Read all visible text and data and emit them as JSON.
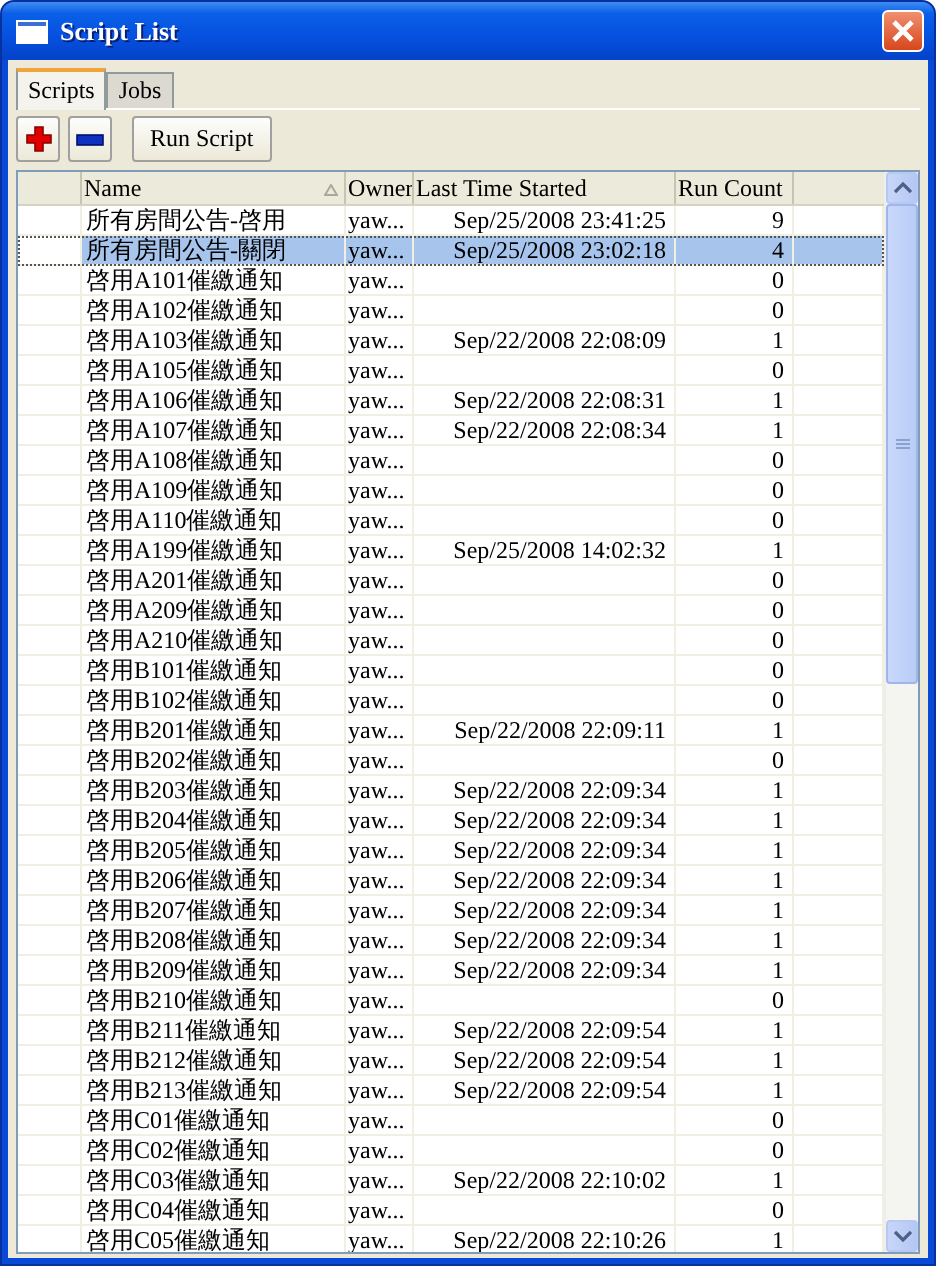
{
  "window": {
    "title": "Script List"
  },
  "tabs": [
    {
      "label": "Scripts",
      "selected": true
    },
    {
      "label": "Jobs",
      "selected": false
    }
  ],
  "toolbar": [
    {
      "kind": "add"
    },
    {
      "kind": "remove"
    },
    {
      "kind": "text",
      "label": "Run Script"
    }
  ],
  "table": {
    "columns": [
      {
        "label": "Name",
        "sorted": true
      },
      {
        "label": "Owner",
        "sorted": false
      },
      {
        "label": "Last Time Started",
        "sorted": false
      },
      {
        "label": "Run Count",
        "sorted": false
      }
    ],
    "rows": [
      {
        "name": "所有房間公告-啓用",
        "owner": "yaw...",
        "last_started": "Sep/25/2008 23:41:25",
        "run_count": "9",
        "selected": false
      },
      {
        "name": "所有房間公告-關閉",
        "owner": "yaw...",
        "last_started": "Sep/25/2008 23:02:18",
        "run_count": "4",
        "selected": true
      },
      {
        "name": "啓用A101催繳通知",
        "owner": "yaw...",
        "run_count": "0",
        "selected": false
      },
      {
        "name": "啓用A102催繳通知",
        "owner": "yaw...",
        "run_count": "0",
        "selected": false
      },
      {
        "name": "啓用A103催繳通知",
        "owner": "yaw...",
        "last_started": "Sep/22/2008 22:08:09",
        "run_count": "1",
        "selected": false
      },
      {
        "name": "啓用A105催繳通知",
        "owner": "yaw...",
        "run_count": "0",
        "selected": false
      },
      {
        "name": "啓用A106催繳通知",
        "owner": "yaw...",
        "last_started": "Sep/22/2008 22:08:31",
        "run_count": "1",
        "selected": false
      },
      {
        "name": "啓用A107催繳通知",
        "owner": "yaw...",
        "last_started": "Sep/22/2008 22:08:34",
        "run_count": "1",
        "selected": false
      },
      {
        "name": "啓用A108催繳通知",
        "owner": "yaw...",
        "run_count": "0",
        "selected": false
      },
      {
        "name": "啓用A109催繳通知",
        "owner": "yaw...",
        "run_count": "0",
        "selected": false
      },
      {
        "name": "啓用A110催繳通知",
        "owner": "yaw...",
        "run_count": "0",
        "selected": false
      },
      {
        "name": "啓用A199催繳通知",
        "owner": "yaw...",
        "last_started": "Sep/25/2008 14:02:32",
        "run_count": "1",
        "selected": false
      },
      {
        "name": "啓用A201催繳通知",
        "owner": "yaw...",
        "run_count": "0",
        "selected": false
      },
      {
        "name": "啓用A209催繳通知",
        "owner": "yaw...",
        "run_count": "0",
        "selected": false
      },
      {
        "name": "啓用A210催繳通知",
        "owner": "yaw...",
        "run_count": "0",
        "selected": false
      },
      {
        "name": "啓用B101催繳通知",
        "owner": "yaw...",
        "run_count": "0",
        "selected": false
      },
      {
        "name": "啓用B102催繳通知",
        "owner": "yaw...",
        "run_count": "0",
        "selected": false
      },
      {
        "name": "啓用B201催繳通知",
        "owner": "yaw...",
        "last_started": "Sep/22/2008 22:09:11",
        "run_count": "1",
        "selected": false
      },
      {
        "name": "啓用B202催繳通知",
        "owner": "yaw...",
        "run_count": "0",
        "selected": false
      },
      {
        "name": "啓用B203催繳通知",
        "owner": "yaw...",
        "last_started": "Sep/22/2008 22:09:34",
        "run_count": "1",
        "selected": false
      },
      {
        "name": "啓用B204催繳通知",
        "owner": "yaw...",
        "last_started": "Sep/22/2008 22:09:34",
        "run_count": "1",
        "selected": false
      },
      {
        "name": "啓用B205催繳通知",
        "owner": "yaw...",
        "last_started": "Sep/22/2008 22:09:34",
        "run_count": "1",
        "selected": false
      },
      {
        "name": "啓用B206催繳通知",
        "owner": "yaw...",
        "last_started": "Sep/22/2008 22:09:34",
        "run_count": "1",
        "selected": false
      },
      {
        "name": "啓用B207催繳通知",
        "owner": "yaw...",
        "last_started": "Sep/22/2008 22:09:34",
        "run_count": "1",
        "selected": false
      },
      {
        "name": "啓用B208催繳通知",
        "owner": "yaw...",
        "last_started": "Sep/22/2008 22:09:34",
        "run_count": "1",
        "selected": false
      },
      {
        "name": "啓用B209催繳通知",
        "owner": "yaw...",
        "last_started": "Sep/22/2008 22:09:34",
        "run_count": "1",
        "selected": false
      },
      {
        "name": "啓用B210催繳通知",
        "owner": "yaw...",
        "run_count": "0",
        "selected": false
      },
      {
        "name": "啓用B211催繳通知",
        "owner": "yaw...",
        "last_started": "Sep/22/2008 22:09:54",
        "run_count": "1",
        "selected": false
      },
      {
        "name": "啓用B212催繳通知",
        "owner": "yaw...",
        "last_started": "Sep/22/2008 22:09:54",
        "run_count": "1",
        "selected": false
      },
      {
        "name": "啓用B213催繳通知",
        "owner": "yaw...",
        "last_started": "Sep/22/2008 22:09:54",
        "run_count": "1",
        "selected": false
      },
      {
        "name": "啓用C01催繳通知",
        "owner": "yaw...",
        "run_count": "0",
        "selected": false
      },
      {
        "name": "啓用C02催繳通知",
        "owner": "yaw...",
        "run_count": "0",
        "selected": false
      },
      {
        "name": "啓用C03催繳通知",
        "owner": "yaw...",
        "last_started": "Sep/22/2008 22:10:02",
        "run_count": "1",
        "selected": false
      },
      {
        "name": "啓用C04催繳通知",
        "owner": "yaw...",
        "run_count": "0",
        "selected": false
      },
      {
        "name": "啓用C05催繳通知",
        "owner": "yaw...",
        "last_started": "Sep/22/2008 22:10:26",
        "run_count": "1",
        "selected": false
      }
    ]
  }
}
